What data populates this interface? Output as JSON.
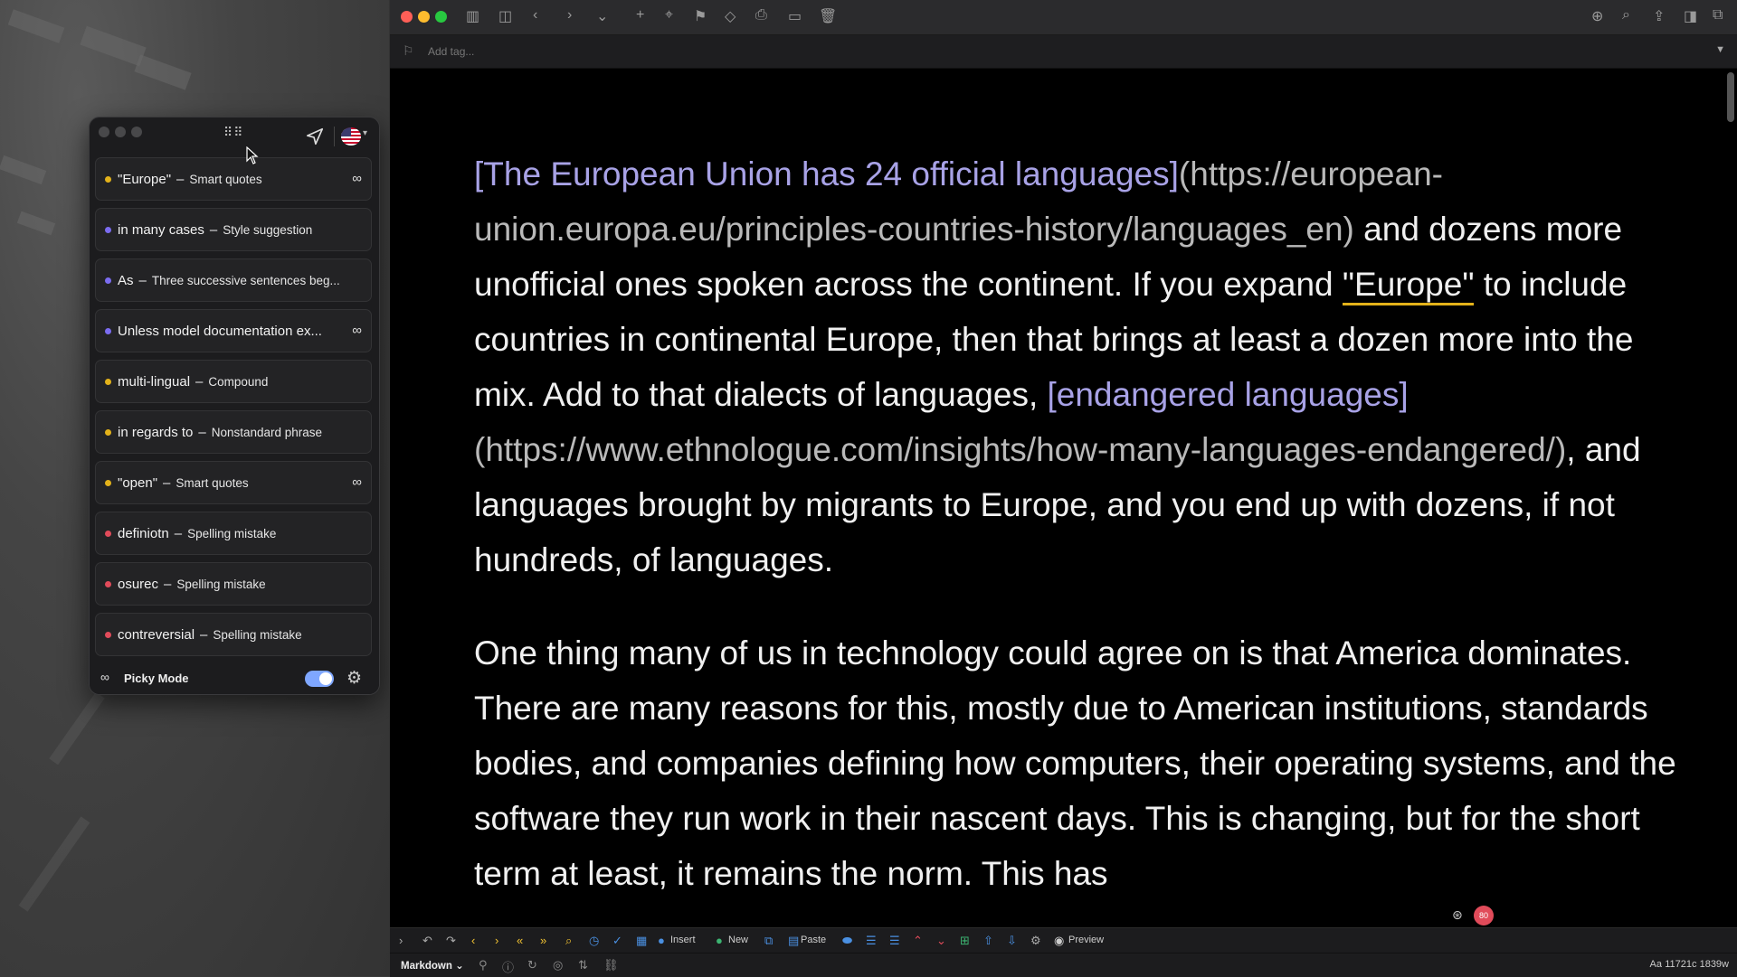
{
  "panel": {
    "items": [
      {
        "word": "\"Europe\"",
        "kind": "Smart quotes",
        "color": "#e3b21a",
        "infinity": true
      },
      {
        "word": "in many cases",
        "kind": "Style suggestion",
        "color": "#7b6cf0",
        "infinity": false
      },
      {
        "word": "As",
        "kind": "Three successive sentences beg...",
        "color": "#7b6cf0",
        "infinity": false
      },
      {
        "word": "Unless model documentation ex...",
        "kind": "",
        "color": "#7b6cf0",
        "infinity": true
      },
      {
        "word": "multi-lingual",
        "kind": "Compound",
        "color": "#e3b21a",
        "infinity": false
      },
      {
        "word": "in regards to",
        "kind": "Nonstandard phrase",
        "color": "#e3b21a",
        "infinity": false
      },
      {
        "word": "\"open\"",
        "kind": "Smart quotes",
        "color": "#e3b21a",
        "infinity": true
      },
      {
        "word": "definiotn",
        "kind": "Spelling mistake",
        "color": "#e14b5a",
        "infinity": false
      },
      {
        "word": "osurec",
        "kind": "Spelling mistake",
        "color": "#e14b5a",
        "infinity": false
      },
      {
        "word": "contreversial",
        "kind": "Spelling mistake",
        "color": "#e14b5a",
        "infinity": false
      }
    ],
    "dash": "–",
    "picky_label": "Picky Mode"
  },
  "editor": {
    "tag_placeholder": "Add tag...",
    "p1": {
      "link1_text": "[The European Union has 24 official languages]",
      "link1_url": "(https://european-union.europa.eu/principles-countries-history/languages_en)",
      "t1": " and dozens more unofficial ones spoken across the continent. If you expand ",
      "flagged": "\"Europe\"",
      "t2": " to include countries in continental Europe, then that brings at least a dozen more into the mix. Add to that dialects of languages, ",
      "link2_text": "[endangered languages]",
      "link2_url": "(https://www.ethnologue.com/insights/how-many-languages-endangered/)",
      "t3": ", and languages brought by migrants to Europe, and you end up with dozens, if not hundreds, of languages."
    },
    "p2": "One thing many of us in technology could agree on is that America dominates. There are many reasons for this, mostly due to American institutions, standards bodies, and companies defining how computers, their operating systems, and the software they run work in their nascent days. This is changing, but for the short term at least, it remains the norm. This has",
    "floaty_count": "80",
    "toolbar": {
      "insert": "Insert",
      "new": "New",
      "paste": "Paste",
      "preview": "Preview"
    },
    "status": {
      "mode": "Markdown",
      "aa": "Aa",
      "stats": "11721c 1839w"
    }
  }
}
